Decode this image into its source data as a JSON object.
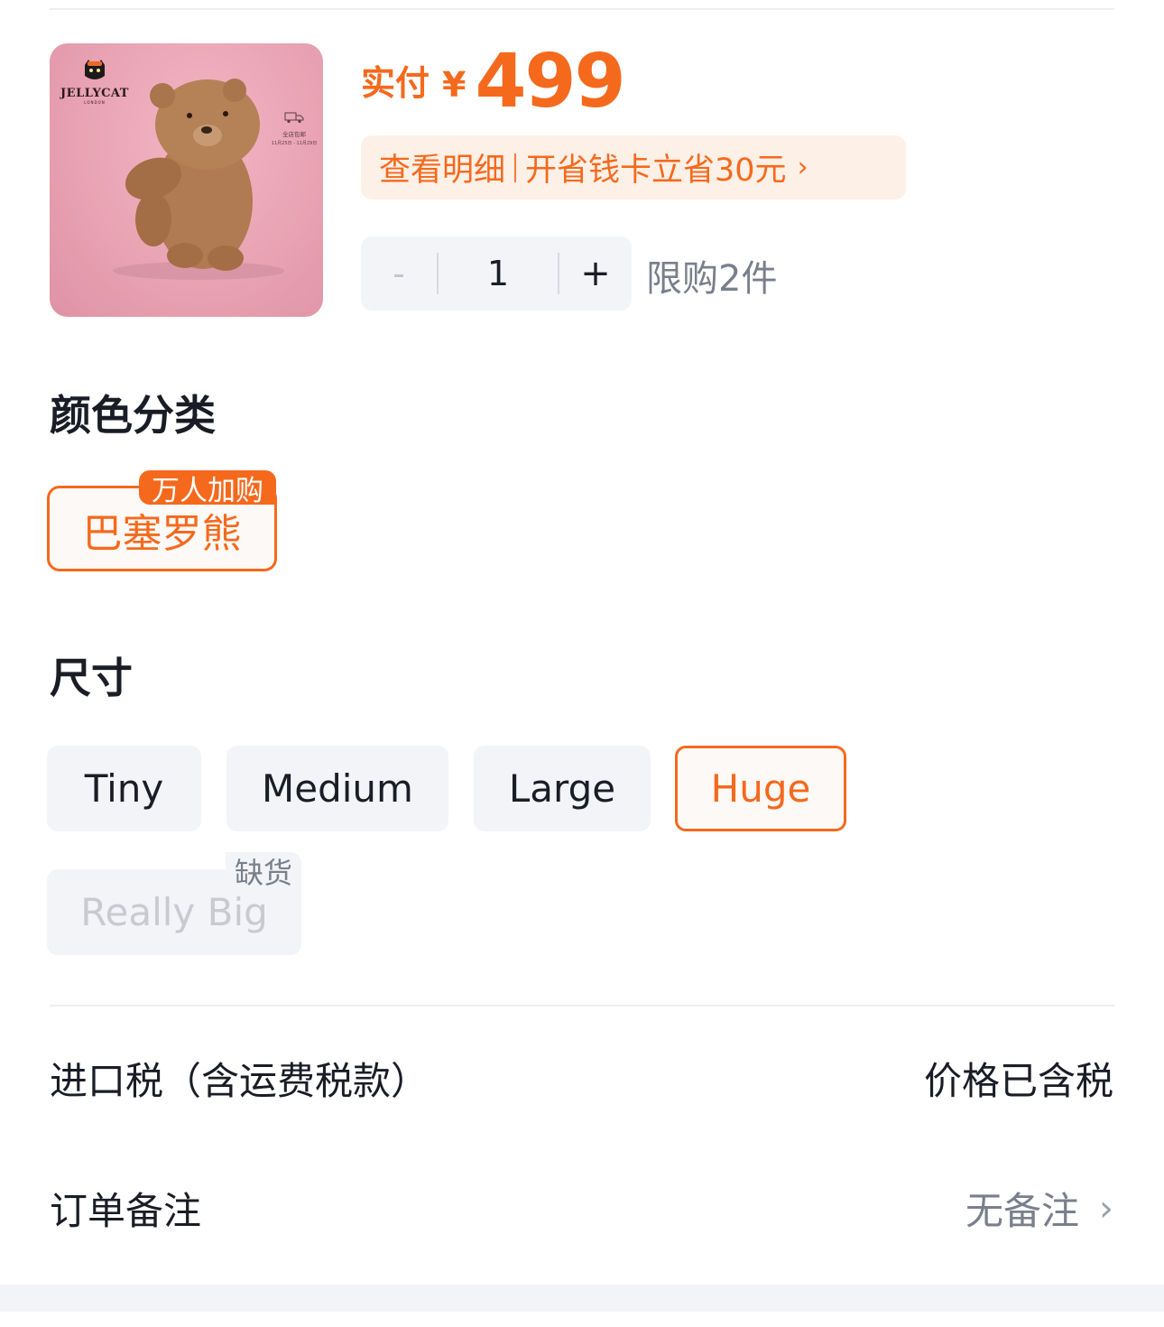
{
  "product": {
    "image": {
      "brand_logo_text": "JELLYCAT",
      "brand_logo_sub": "LONDON",
      "shipping_label": "全店包邮",
      "shipping_date": "11月25日 - 11月29日"
    },
    "price_label": "实付",
    "currency": "¥",
    "price": "499",
    "promo_detail": "查看明细",
    "promo_card": "开省钱卡立省30元",
    "quantity": "1",
    "minus_symbol": "-",
    "plus_symbol": "+",
    "limit_text": "限购2件"
  },
  "color_section": {
    "title": "颜色分类",
    "options": [
      {
        "label": "巴塞罗熊",
        "badge": "万人加购",
        "selected": true
      }
    ]
  },
  "size_section": {
    "title": "尺寸",
    "options": [
      {
        "label": "Tiny",
        "state": "normal"
      },
      {
        "label": "Medium",
        "state": "normal"
      },
      {
        "label": "Large",
        "state": "normal"
      },
      {
        "label": "Huge",
        "state": "selected"
      },
      {
        "label": "Really Big",
        "state": "out_of_stock",
        "badge": "缺货"
      }
    ]
  },
  "tax_row": {
    "label": "进口税（含运费税款）",
    "value": "价格已含税"
  },
  "note_row": {
    "label": "订单备注",
    "value": "无备注"
  },
  "colors": {
    "accent": "#f5691d",
    "promo_bg": "#fdf0e6",
    "chip_bg": "#f3f4f7",
    "muted_text": "#7a7f8c"
  }
}
